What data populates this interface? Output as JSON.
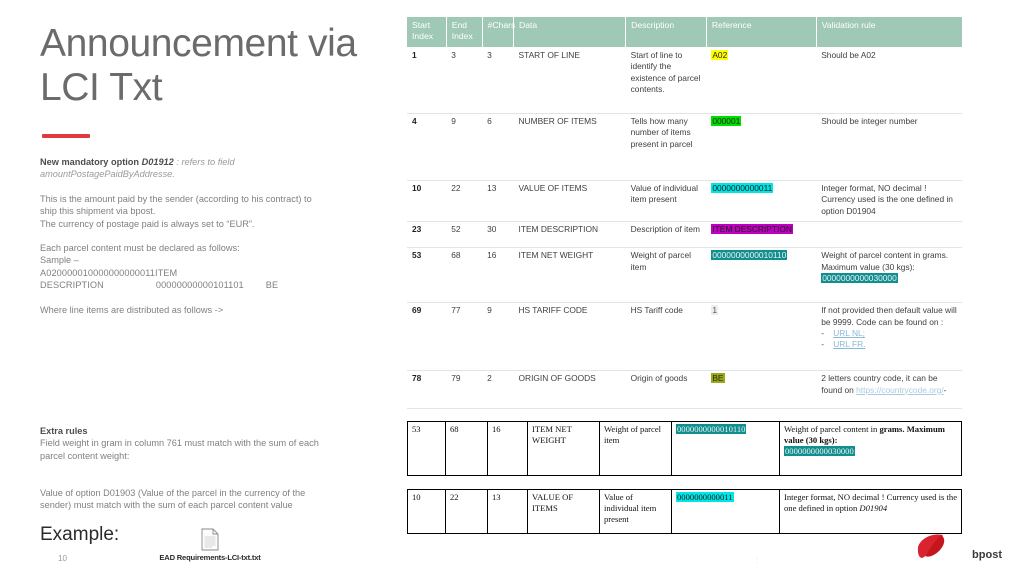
{
  "slide": {
    "title": "Announcement via LCI Txt",
    "page_number": "10",
    "accent_color": "#e03a3e",
    "footer_dot": ":"
  },
  "intro": {
    "line1_bold": "New mandatory option",
    "line1_code": "D01912",
    "line1_rest": ": refers to field",
    "line2_italic": "amountPostagePaidByAddresse.",
    "para1_line1": "This is the amount paid by the sender (according to his contract) to",
    "para1_line2": "ship this shipment via bpost.",
    "para1_line3": "The currency of postage paid is always set to “EUR”.",
    "para2_line1": "Each parcel content must be declared as follows:",
    "para2_line2": "Sample –",
    "para2_line3": "A020000010000000000011ITEM",
    "para2_line4a": "DESCRIPTION",
    "para2_line4b": "00000000000101101",
    "para2_line4c": "BE",
    "para3": "Where line items are distributed as follows  ->"
  },
  "extra_rules": {
    "heading": "Extra rules",
    "line1": "Field weight in gram in column 761 must match with the sum of each",
    "line2": "parcel content weight:"
  },
  "value_rule": {
    "line1": "Value of option D01903 (Value of the parcel in the currency of the",
    "line2": "sender) must match with the sum of each parcel content value"
  },
  "example": {
    "label": "Example:",
    "attachment_name": "EAD Requirements-LCI-txt.txt",
    "attachment_icon": "document-icon"
  },
  "logo": {
    "brand": "bpost",
    "icon": "bpost-swoosh-icon",
    "color": "#d9232e"
  },
  "main_table": {
    "headers": [
      "Start Index",
      "End Index",
      "#Chars",
      "Data",
      "Description",
      "Reference",
      "Validation rule"
    ],
    "header_bg": "#9fc8b7",
    "rows": [
      {
        "start": "1",
        "end": "3",
        "chars": "3",
        "data": "START OF LINE",
        "description": "Start of line to identify the existence of parcel contents.",
        "reference": "A02",
        "ref_style": "yellow",
        "validation": "Should be A02"
      },
      {
        "start": "4",
        "end": "9",
        "chars": "6",
        "data": "NUMBER OF ITEMS",
        "description": "Tells how many number of items present in parcel",
        "reference": "000001",
        "ref_style": "green",
        "validation": "Should be integer number"
      },
      {
        "start": "10",
        "end": "22",
        "chars": "13",
        "data": "VALUE OF ITEMS",
        "description": "Value of individual item present",
        "reference": "0000000000011",
        "ref_style": "cyan",
        "validation": "Integer format, NO decimal ! Currency used is the one defined in option D01904"
      },
      {
        "start": "23",
        "end": "52",
        "chars": "30",
        "data": "ITEM DESCRIPTION",
        "description": "Description of item",
        "reference": "ITEM DESCRIPTION",
        "ref_style": "magenta",
        "validation": ""
      },
      {
        "start": "53",
        "end": "68",
        "chars": "16",
        "data": "ITEM NET WEIGHT",
        "description": "Weight of parcel item",
        "reference": "0000000000010110",
        "ref_style": "teal",
        "validation": "Weight of parcel content in grams. Maximum value (30 kgs):",
        "validation_extra": "0000000000030000",
        "validation_extra_style": "teal"
      },
      {
        "start": "69",
        "end": "77",
        "chars": "9",
        "data": "HS TARIFF CODE",
        "description": "HS Tariff code",
        "reference": "1",
        "ref_style": "grey",
        "validation": "If not provided then default value will be 9999. Code can be found on :",
        "links": [
          "URL NL;",
          "URL FR."
        ]
      },
      {
        "start": "78",
        "end": "79",
        "chars": "2",
        "data": "ORIGIN OF GOODS",
        "description": "Origin of goods",
        "reference": "BE",
        "ref_style": "olive",
        "validation": "2 letters country code, it can be found on",
        "validation_link": "https://countrycode.org/",
        "validation_tail": "-"
      }
    ]
  },
  "sub_tables": [
    {
      "start": "53",
      "end": "68",
      "chars": "16",
      "data": "ITEM NET WEIGHT",
      "description": "Weight of parcel item",
      "reference": "0000000000010110",
      "ref_style": "teal",
      "validation_plain": "Weight of parcel content in ",
      "validation_bold": "grams. Maximum value (30 kgs):",
      "validation_extra": "0000000000030000"
    },
    {
      "start": "10",
      "end": "22",
      "chars": "13",
      "data": "VALUE OF ITEMS",
      "description": "Value of individual item present",
      "reference": "0000000000011",
      "ref_style": "cyan",
      "validation_plain": "Integer format, NO decimal ! Currency used is the one defined in option ",
      "validation_italic": "D01904"
    }
  ]
}
